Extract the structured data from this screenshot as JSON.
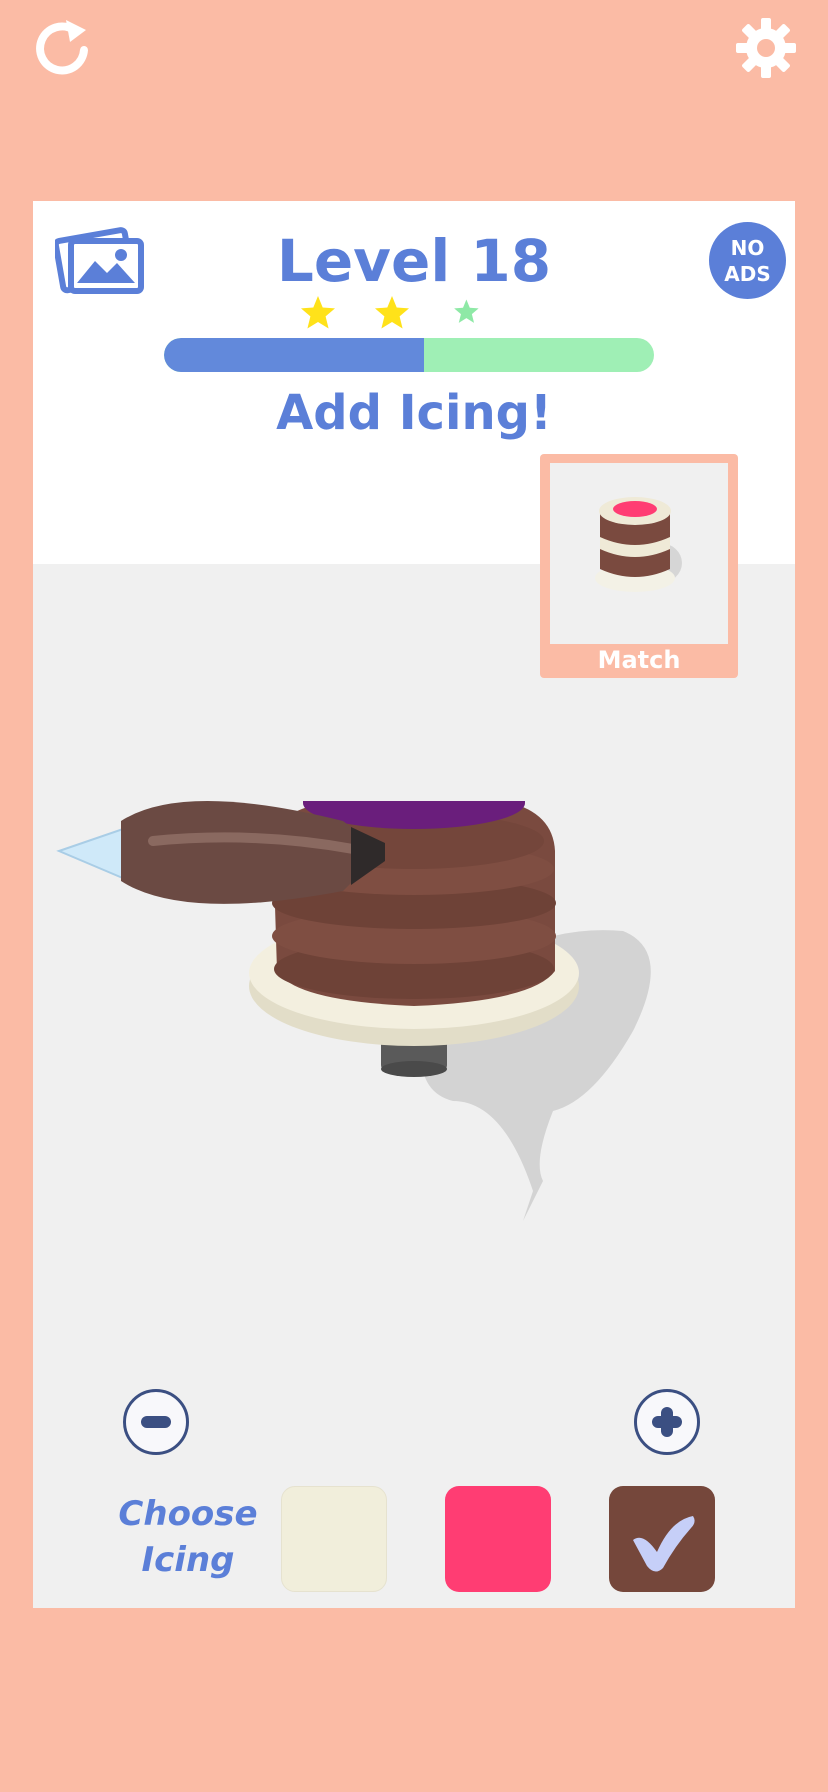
{
  "top_bar": {
    "restart_icon": "restart-icon",
    "settings_icon": "gear-icon"
  },
  "header": {
    "level_title": "Level 18",
    "no_ads_line1": "NO",
    "no_ads_line2": "ADS",
    "gallery_icon": "gallery-icon",
    "stars_earned": 2,
    "stars_total": 3,
    "progress_fraction": 0.53,
    "instruction": "Add Icing!"
  },
  "match_card": {
    "label": "Match"
  },
  "controls": {
    "minus_icon": "minus-icon",
    "plus_icon": "plus-icon",
    "choose_line1": "Choose",
    "choose_line2": "Icing"
  },
  "icing_options": [
    {
      "name": "cream",
      "color": "#f1eedb",
      "selected": false
    },
    {
      "name": "pink",
      "color": "#ff3d73",
      "selected": false
    },
    {
      "name": "chocolate",
      "color": "#75473b",
      "selected": true
    }
  ],
  "colors": {
    "background": "#fbbba5",
    "accent_blue": "#5b7fd8",
    "progress_done": "#6289db",
    "progress_remaining": "#9fefb5",
    "star": "#ffe21a",
    "star_pending": "#8ee9a6"
  }
}
